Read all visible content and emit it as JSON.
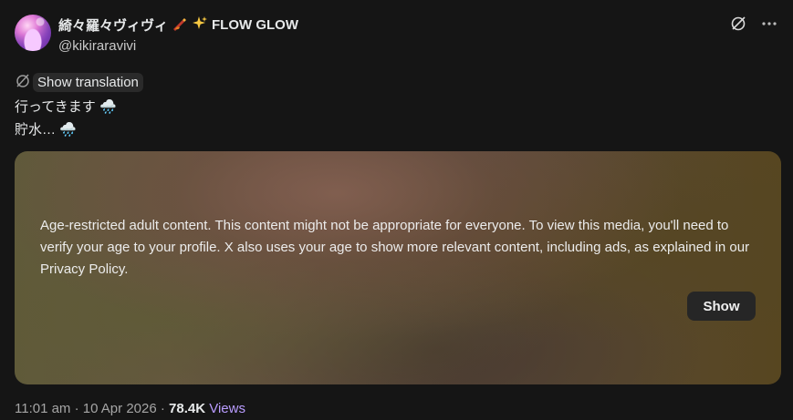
{
  "author": {
    "display_name": "綺々羅々ヴィヴィ",
    "display_suffix": "FLOW GLOW",
    "handle": "@kikiraravivi",
    "name_emojis": [
      "pen-fire-emoji",
      "sparkles-emoji"
    ]
  },
  "actions": {
    "icons": [
      "grok-icon",
      "more-icon"
    ]
  },
  "translation": {
    "button_label": "Show translation"
  },
  "post_text": {
    "line1": "行ってきます",
    "line1_emoji": "🌧️",
    "line2": "貯水…",
    "line2_emoji": "🌧️"
  },
  "media": {
    "warning": "Age-restricted adult content. This content might not be appropriate for everyone. To view this media, you'll need to verify your age to your profile. X also uses your age to show more relevant content, including ads, as explained in our Privacy Policy.",
    "show_label": "Show"
  },
  "meta": {
    "time": "11:01 am",
    "separator": " · ",
    "date": "10 Apr 2026",
    "views_count": "78.4K",
    "views_label": "Views"
  },
  "colors": {
    "background": "#151515",
    "text": "#e7e9ea",
    "accent_views": "#b99cff"
  }
}
